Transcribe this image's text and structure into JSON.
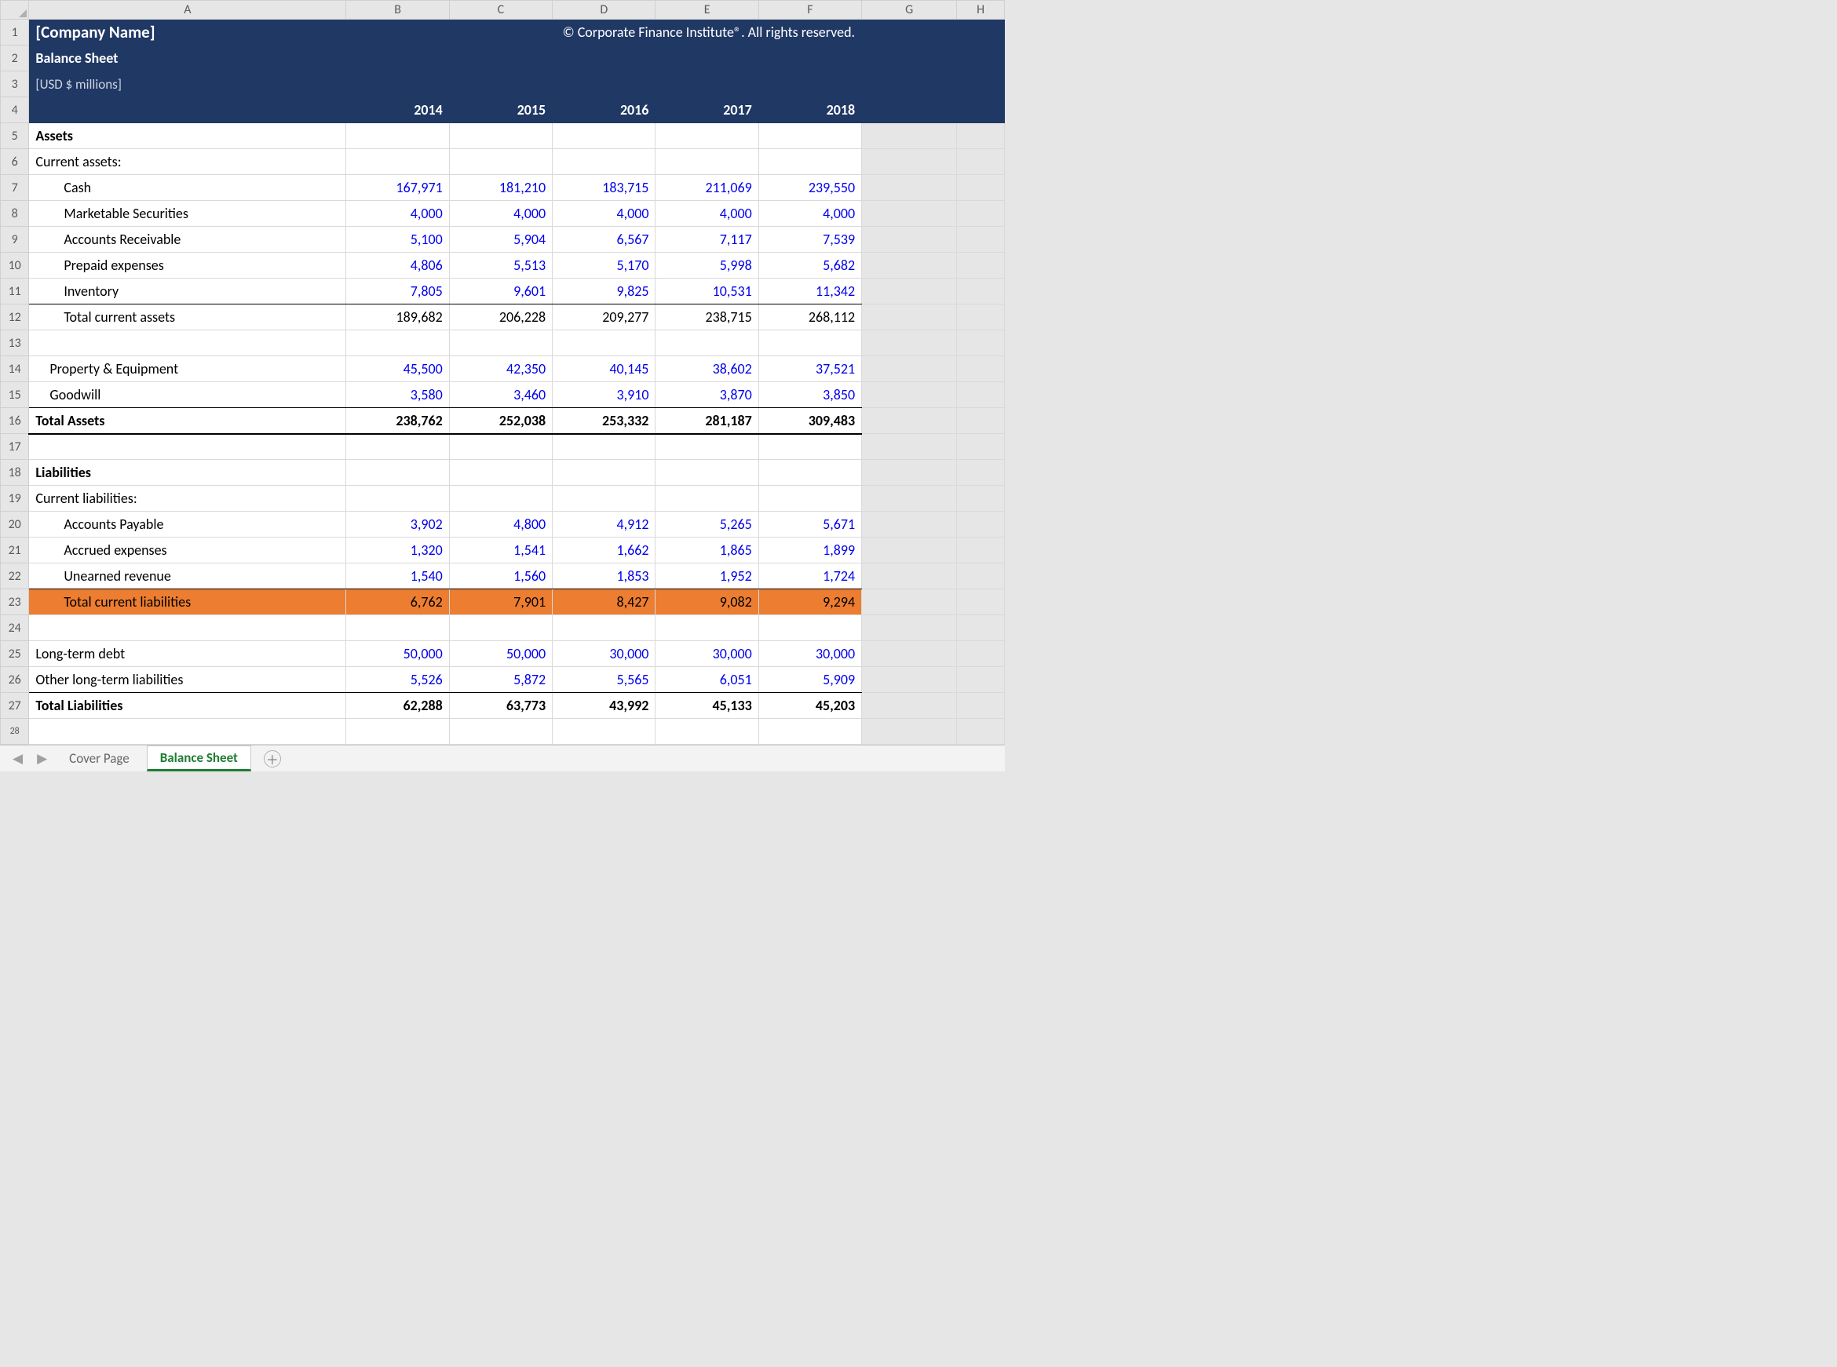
{
  "columns": [
    "A",
    "B",
    "C",
    "D",
    "E",
    "F",
    "G",
    "H"
  ],
  "header": {
    "company": "[Company Name]",
    "title": "Balance Sheet",
    "subtitle": "[USD $ millions]",
    "copyright": "© Corporate Finance Institute®. All rights reserved."
  },
  "years": [
    "2014",
    "2015",
    "2016",
    "2017",
    "2018"
  ],
  "sections": {
    "assets_heading": "Assets",
    "current_assets_label": "Current assets:",
    "liabilities_heading": "Liabilities",
    "current_liabilities_label": "Current liabilities:"
  },
  "rows": {
    "cash": {
      "label": "Cash",
      "values": [
        "167,971",
        "181,210",
        "183,715",
        "211,069",
        "239,550"
      ]
    },
    "ms": {
      "label": "Marketable Securities",
      "values": [
        "4,000",
        "4,000",
        "4,000",
        "4,000",
        "4,000"
      ]
    },
    "ar": {
      "label": "Accounts Receivable",
      "values": [
        "5,100",
        "5,904",
        "6,567",
        "7,117",
        "7,539"
      ]
    },
    "prepaid": {
      "label": "Prepaid expenses",
      "values": [
        "4,806",
        "5,513",
        "5,170",
        "5,998",
        "5,682"
      ]
    },
    "inventory": {
      "label": "Inventory",
      "values": [
        "7,805",
        "9,601",
        "9,825",
        "10,531",
        "11,342"
      ]
    },
    "tca": {
      "label": "Total current assets",
      "values": [
        "189,682",
        "206,228",
        "209,277",
        "238,715",
        "268,112"
      ]
    },
    "ppe": {
      "label": "Property & Equipment",
      "values": [
        "45,500",
        "42,350",
        "40,145",
        "38,602",
        "37,521"
      ]
    },
    "goodwill": {
      "label": "Goodwill",
      "values": [
        "3,580",
        "3,460",
        "3,910",
        "3,870",
        "3,850"
      ]
    },
    "total_assets": {
      "label": "Total Assets",
      "values": [
        "238,762",
        "252,038",
        "253,332",
        "281,187",
        "309,483"
      ]
    },
    "ap": {
      "label": "Accounts Payable",
      "values": [
        "3,902",
        "4,800",
        "4,912",
        "5,265",
        "5,671"
      ]
    },
    "accrued": {
      "label": "Accrued expenses",
      "values": [
        "1,320",
        "1,541",
        "1,662",
        "1,865",
        "1,899"
      ]
    },
    "unearned": {
      "label": "Unearned revenue",
      "values": [
        "1,540",
        "1,560",
        "1,853",
        "1,952",
        "1,724"
      ]
    },
    "tcl": {
      "label": "Total current liabilities",
      "values": [
        "6,762",
        "7,901",
        "8,427",
        "9,082",
        "9,294"
      ]
    },
    "ltd": {
      "label": "Long-term debt",
      "values": [
        "50,000",
        "50,000",
        "30,000",
        "30,000",
        "30,000"
      ]
    },
    "other_lt": {
      "label": "Other long-term liabilities",
      "values": [
        "5,526",
        "5,872",
        "5,565",
        "6,051",
        "5,909"
      ]
    },
    "total_liab": {
      "label": "Total Liabilities",
      "values": [
        "62,288",
        "63,773",
        "43,992",
        "45,133",
        "45,203"
      ]
    }
  },
  "tabs": {
    "cover": "Cover Page",
    "balance": "Balance Sheet"
  },
  "row_labels": [
    "1",
    "2",
    "3",
    "4",
    "5",
    "6",
    "7",
    "8",
    "9",
    "10",
    "11",
    "12",
    "13",
    "14",
    "15",
    "16",
    "17",
    "18",
    "19",
    "20",
    "21",
    "22",
    "23",
    "24",
    "25",
    "26",
    "27",
    "28"
  ],
  "chart_data": {
    "type": "table",
    "title": "Balance Sheet",
    "columns": [
      "2014",
      "2015",
      "2016",
      "2017",
      "2018"
    ],
    "rows": [
      {
        "name": "Cash",
        "values": [
          167971,
          181210,
          183715,
          211069,
          239550
        ]
      },
      {
        "name": "Marketable Securities",
        "values": [
          4000,
          4000,
          4000,
          4000,
          4000
        ]
      },
      {
        "name": "Accounts Receivable",
        "values": [
          5100,
          5904,
          6567,
          7117,
          7539
        ]
      },
      {
        "name": "Prepaid expenses",
        "values": [
          4806,
          5513,
          5170,
          5998,
          5682
        ]
      },
      {
        "name": "Inventory",
        "values": [
          7805,
          9601,
          9825,
          10531,
          11342
        ]
      },
      {
        "name": "Total current assets",
        "values": [
          189682,
          206228,
          209277,
          238715,
          268112
        ]
      },
      {
        "name": "Property & Equipment",
        "values": [
          45500,
          42350,
          40145,
          38602,
          37521
        ]
      },
      {
        "name": "Goodwill",
        "values": [
          3580,
          3460,
          3910,
          3870,
          3850
        ]
      },
      {
        "name": "Total Assets",
        "values": [
          238762,
          252038,
          253332,
          281187,
          309483
        ]
      },
      {
        "name": "Accounts Payable",
        "values": [
          3902,
          4800,
          4912,
          5265,
          5671
        ]
      },
      {
        "name": "Accrued expenses",
        "values": [
          1320,
          1541,
          1662,
          1865,
          1899
        ]
      },
      {
        "name": "Unearned revenue",
        "values": [
          1540,
          1560,
          1853,
          1952,
          1724
        ]
      },
      {
        "name": "Total current liabilities",
        "values": [
          6762,
          7901,
          8427,
          9082,
          9294
        ]
      },
      {
        "name": "Long-term debt",
        "values": [
          50000,
          50000,
          30000,
          30000,
          30000
        ]
      },
      {
        "name": "Other long-term liabilities",
        "values": [
          5526,
          5872,
          5565,
          6051,
          5909
        ]
      },
      {
        "name": "Total Liabilities",
        "values": [
          62288,
          63773,
          43992,
          45133,
          45203
        ]
      }
    ]
  }
}
